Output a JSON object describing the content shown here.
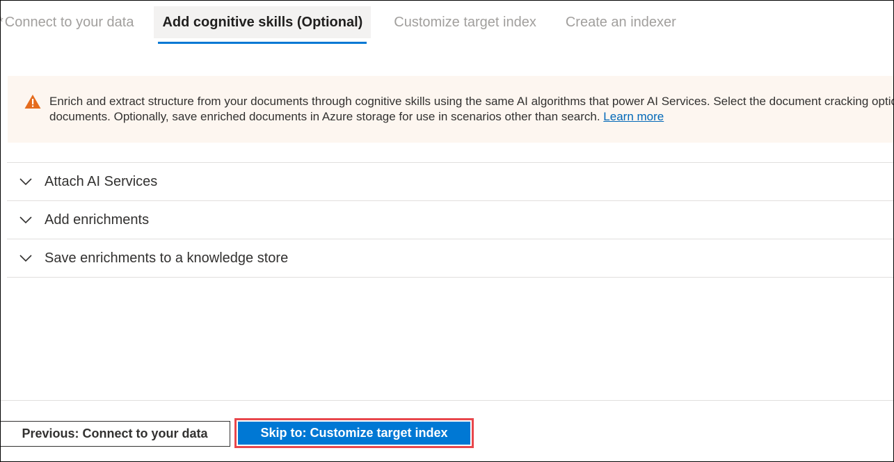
{
  "tabs": [
    {
      "mark": "*",
      "label": "Connect to your data"
    },
    {
      "label": "Add cognitive skills (Optional)"
    },
    {
      "label": "Customize target index"
    },
    {
      "label": "Create an indexer"
    }
  ],
  "banner": {
    "icon": "warning-icon",
    "line1": "Enrich and extract structure from your documents through cognitive skills using the same AI algorithms that power AI Services. Select the document cracking options for your",
    "line2": "documents. Optionally, save enriched documents in Azure storage for use in scenarios other than search.",
    "link": "Learn more"
  },
  "accordion": [
    {
      "label": "Attach AI Services"
    },
    {
      "label": "Add enrichments"
    },
    {
      "label": "Save enrichments to a knowledge store"
    }
  ],
  "footer": {
    "prev_label": "Previous: Connect to your data",
    "skip_label": "Skip to: Customize target index"
  },
  "colors": {
    "accent": "#0078d4",
    "warning": "#e56c1e",
    "banner_bg": "#fdf6f0",
    "highlight": "#e8474c"
  }
}
